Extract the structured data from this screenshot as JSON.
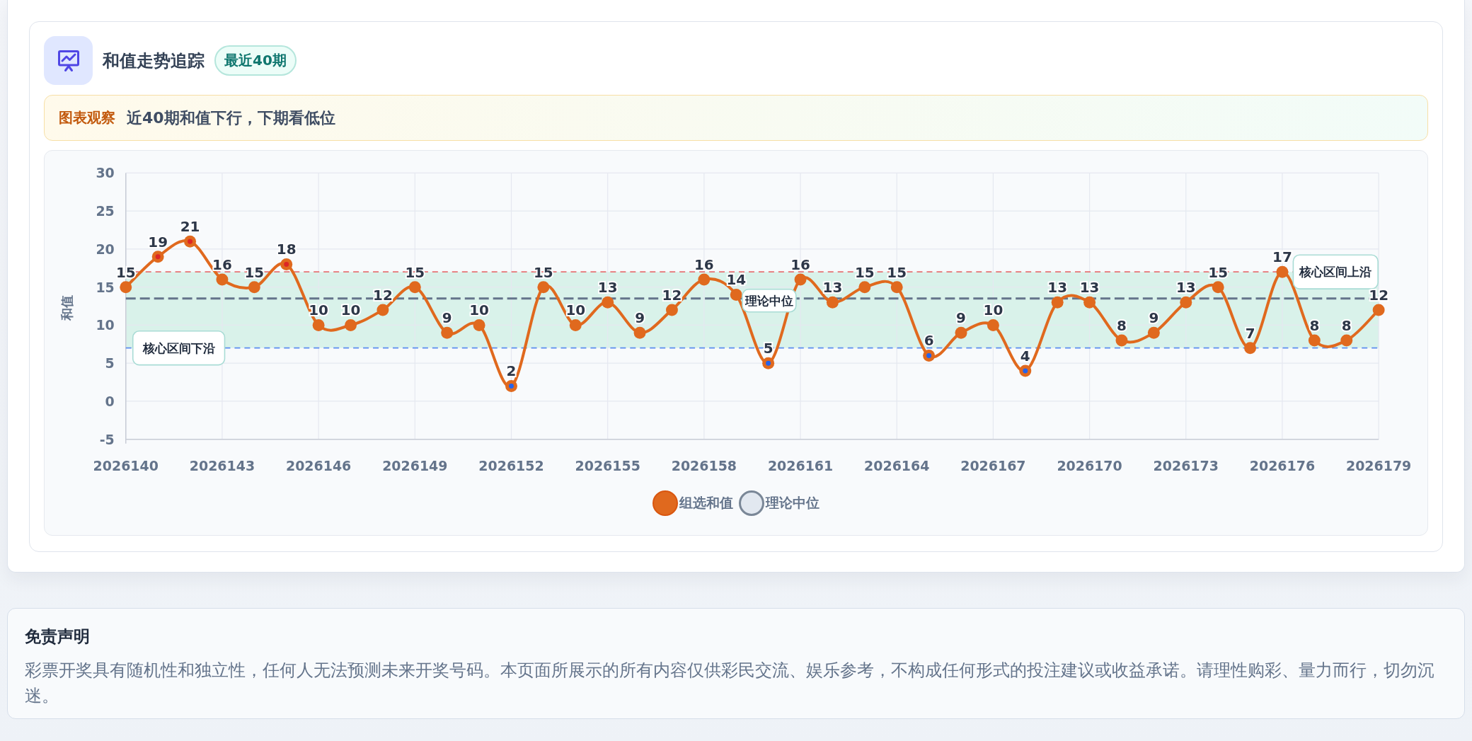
{
  "card": {
    "title": "和值走势追踪",
    "badge": "最近40期",
    "observation": {
      "label": "图表观察",
      "text": "近40期和值下行，下期看低位"
    },
    "chart_data": {
      "type": "line",
      "ylabel": "和值",
      "x": [
        2026140,
        2026141,
        2026142,
        2026143,
        2026144,
        2026145,
        2026146,
        2026147,
        2026148,
        2026149,
        2026150,
        2026151,
        2026152,
        2026153,
        2026154,
        2026155,
        2026156,
        2026157,
        2026158,
        2026159,
        2026160,
        2026161,
        2026162,
        2026163,
        2026164,
        2026165,
        2026166,
        2026167,
        2026168,
        2026169,
        2026170,
        2026171,
        2026172,
        2026173,
        2026174,
        2026175,
        2026176,
        2026177,
        2026178,
        2026179
      ],
      "series": [
        {
          "name": "组选和值",
          "color": "#e0691e",
          "marker": "o",
          "values": [
            15,
            19,
            21,
            16,
            15,
            18,
            10,
            10,
            12,
            15,
            9,
            10,
            2,
            15,
            10,
            13,
            9,
            12,
            16,
            14,
            5,
            16,
            13,
            15,
            15,
            6,
            9,
            10,
            4,
            13,
            13,
            8,
            9,
            13,
            15,
            7,
            17,
            8,
            8,
            12
          ]
        }
      ],
      "ylim": [
        -5,
        30
      ],
      "yticks": [
        -5,
        0,
        5,
        10,
        15,
        20,
        25,
        30
      ],
      "xlim": [
        2026140,
        2026179
      ],
      "xticks": [
        2026140,
        2026143,
        2026146,
        2026149,
        2026152,
        2026155,
        2026158,
        2026161,
        2026164,
        2026167,
        2026170,
        2026173,
        2026176,
        2026179
      ],
      "grid": true,
      "data_labels": true,
      "bands": [
        {
          "axis": "y",
          "from": 7,
          "to": 17,
          "color": "#d9f2ea"
        }
      ],
      "ref_lines": [
        {
          "axis": "y",
          "value": 17,
          "label": "核心区间上沿",
          "color": "#e57373"
        },
        {
          "axis": "y",
          "value": 7,
          "label": "核心区间下沿",
          "color": "#5b8def"
        },
        {
          "axis": "y",
          "value": 13.5,
          "label": "理论中位",
          "color": "#64748b"
        }
      ]
    },
    "legend": [
      {
        "kind": "series"
      },
      {
        "kind": "reference",
        "label": "理论中位"
      }
    ]
  },
  "disclaimer": {
    "title": "免责声明",
    "text": "彩票开奖具有随机性和独立性，任何人无法预测未来开奖号码。本页面所展示的所有内容仅供彩民交流、娱乐参考，不构成任何形式的投注建议或收益承诺。请理性购彩、量力而行，切勿沉迷。"
  }
}
